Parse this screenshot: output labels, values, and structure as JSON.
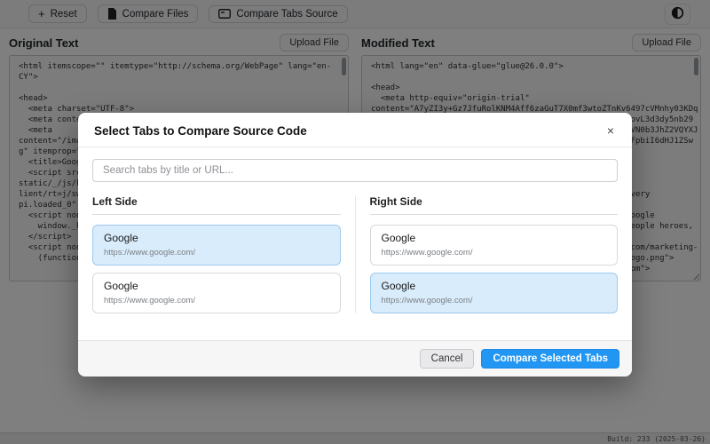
{
  "toolbar": {
    "reset_label": "Reset",
    "reset_icon_glyph": "+",
    "compare_files_label": "Compare Files",
    "compare_tabs_label": "Compare Tabs Source"
  },
  "panels": {
    "original": {
      "title": "Original Text",
      "upload_label": "Upload File",
      "code": "<html itemscope=\"\" itemtype=\"http://schema.org/WebPage\" lang=\"en-\nCY\">\n\n<head>\n  <meta charset=\"UTF-8\">\n  <meta content=\"origin\" name=\"referrer\">\n  <meta\ncontent=\"/images/branding/googleg/1x/googleg_standard_color_128dp.pn\ng\" itemprop=\"image\">\n  <title>Google</title>\n  <script src=\"https://www.gstatic.com/og/_/js/k=og.qtm.en_US.rW\nstatic/_/js/k=gapi.gapi.en.vKvXi8BMCXk.O/m=gapi_iframes,googleapis_c\nlient/rt=j/sw=1/d=1/ed=1/rs=AHpOoo_pTkE0AMVqJ1mSh2UhYqRnZ3AZbA/cb=ga\npi.loaded_0\" async=\"\"></script>\n  <script nonce=\"\">\n    window._hst = Date.now();\n  </script>\n  <script nonce=\"\">\n    (function(){window.google={kEI:'aBcD'};})();"
    },
    "modified": {
      "title": "Modified Text",
      "upload_label": "Upload File",
      "code": "<html lang=\"en\" data-glue=\"glue@26.0.0\">\n\n<head>\n  <meta http-equiv=\"origin-trial\"\ncontent=\"A7yZI3y+Gz7JfuRolKNM4Aff6zaGuT7X0mf3wtoZTnKv6497cVMnhy03KDq\nh5oYLJYsV9wRm2PA8AkAAABneyJvcmlnaW4iOiJodHRwczovL2NkbjovL3d3dy5nb29\nnbGUuY29tOjQ0MyIsImZlYXR1cmUiOiJEaXNhYmxlVGhpcmRQYXJ0eVN0b3JhZ2VQYXJ\ndGl0aW9uaW5nIiwiZXhwaXJ5IjoxNzU3OTgwODAwLCJpc1N1YmRvbWFpbiI6dHJ1ZSw\niaXNUaGlyZFBhcnR5Ijp0cnVlfQ==\">\n  <meta charset=\"utf-8\">\n  <meta name=\"viewport\" content=\"width=device-width\">\n  <meta name=\"theme-color\" content=\"#ffffff\">\n  <title>Google - Helping Build a Safer Internet for Every\none</title>\n  <meta name=\"description\" content=\"From the curious Google\nDoodles to accessibility features, meet the everyday people heroes,\nand stories behind Google.\">\n  <meta itemprop=\"image\" content=\"https://www.gstatic.com/marketing-\ncms/about/app/uploads/2023/08/google-about-og-social-logo.png\">\n  <link rel=\"preconnect\" href=\"https://fonts.gstatic.com\">"
    }
  },
  "modal": {
    "title": "Select Tabs to Compare Source Code",
    "close_glyph": "×",
    "search_placeholder": "Search tabs by title or URL...",
    "left_column": {
      "header": "Left Side",
      "tabs": [
        {
          "title": "Google",
          "url": "https://www.google.com/",
          "selected": true
        },
        {
          "title": "Google",
          "url": "https://www.google.com/",
          "selected": false
        }
      ]
    },
    "right_column": {
      "header": "Right Side",
      "tabs": [
        {
          "title": "Google",
          "url": "https://www.google.com/",
          "selected": false
        },
        {
          "title": "Google",
          "url": "https://www.google.com/",
          "selected": true
        }
      ]
    },
    "footer": {
      "cancel_label": "Cancel",
      "confirm_label": "Compare Selected Tabs"
    }
  },
  "status_bar": {
    "build_text": "Build: 233 (2025-03-26)"
  },
  "colors": {
    "accent": "#2196f3",
    "selected_tab_bg": "#d9ecfb",
    "selected_tab_border": "#9ec9ec",
    "overlay": "rgba(0,0,0,0.5)"
  }
}
